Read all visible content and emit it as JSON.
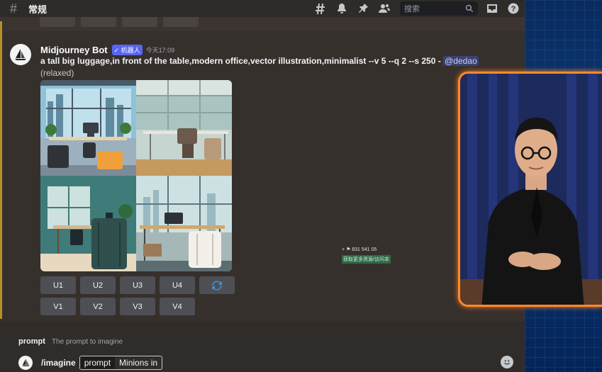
{
  "header": {
    "channel_name": "常规",
    "search_placeholder": "搜索",
    "icons": [
      "threads-icon",
      "bell-icon",
      "pin-icon",
      "members-icon",
      "search-icon",
      "inbox-icon",
      "help-icon"
    ]
  },
  "message": {
    "author": "Midjourney Bot",
    "badge": "✓ 机器人",
    "timestamp": "今天17:09",
    "prompt_text": "a tall big luggage,in front of the table,modern office,vector illustration,minimalist --v 5 --q 2 --s 250 -",
    "mention": "@dedao",
    "mode": "(relaxed)",
    "upscale_buttons": [
      "U1",
      "U2",
      "U3",
      "U4"
    ],
    "variation_buttons": [
      "V1",
      "V2",
      "V3",
      "V4"
    ],
    "reroll_icon": "refresh-icon"
  },
  "overlay_mini": {
    "stats": "+ ⚑ 831  541  05",
    "caption": "获取更多资源/访问本"
  },
  "input": {
    "hint_option": "prompt",
    "hint_text": "The prompt to imagine",
    "command": "/imagine",
    "option_name": "prompt",
    "option_value": "Minions in"
  },
  "colors": {
    "accent": "#5865f2",
    "presenter_border": "#ff8a2a",
    "unread_bar": "#c9a227"
  }
}
